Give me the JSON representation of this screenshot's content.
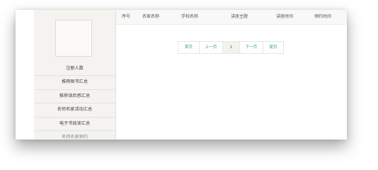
{
  "sidebar": {
    "items": [
      {
        "label": "注册人数"
      },
      {
        "label": "推荐图书汇总"
      },
      {
        "label": "推荐读后感汇总"
      },
      {
        "label": "名师名家活动汇总"
      },
      {
        "label": "电子书阅读汇总"
      },
      {
        "label": "名师名家预约"
      }
    ]
  },
  "table": {
    "columns": [
      "序号",
      "名家名称",
      "学校名称",
      "讲座主题",
      "讲座时间",
      "预约时间"
    ]
  },
  "pagination": {
    "first": "首页",
    "prev": "上一页",
    "current": "1",
    "next": "下一页",
    "last": "尾页"
  }
}
